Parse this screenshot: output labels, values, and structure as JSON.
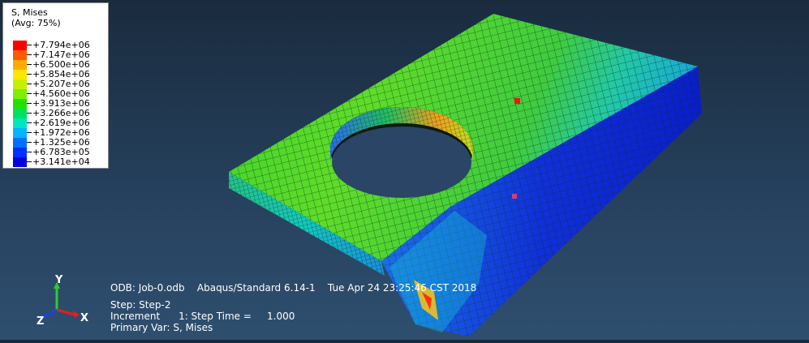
{
  "legend": {
    "title_line1": "S, Mises",
    "title_line2": "(Avg: 75%)",
    "values": [
      "+7.794e+06",
      "+7.147e+06",
      "+6.500e+06",
      "+5.854e+06",
      "+5.207e+06",
      "+4.560e+06",
      "+3.913e+06",
      "+3.266e+06",
      "+2.619e+06",
      "+1.972e+06",
      "+1.325e+06",
      "+6.783e+05",
      "+3.141e+04"
    ],
    "colors": [
      "#ff0000",
      "#ff5a00",
      "#ffaa00",
      "#ffe600",
      "#c6f000",
      "#7cf000",
      "#22e000",
      "#00e060",
      "#00e6c0",
      "#00b6ff",
      "#0070ff",
      "#0030ff",
      "#0000e0"
    ]
  },
  "info": {
    "odb_line": "ODB: Job-0.odb    Abaqus/Standard 6.14-1    Tue Apr 24 23:25:46 CST 2018",
    "step_line": "Step: Step-2",
    "increment_line": "Increment      1: Step Time =     1.000",
    "primary_var_line": "Primary Var: S, Mises"
  },
  "triad": {
    "x_label": "X",
    "y_label": "Y",
    "z_label": "Z"
  }
}
